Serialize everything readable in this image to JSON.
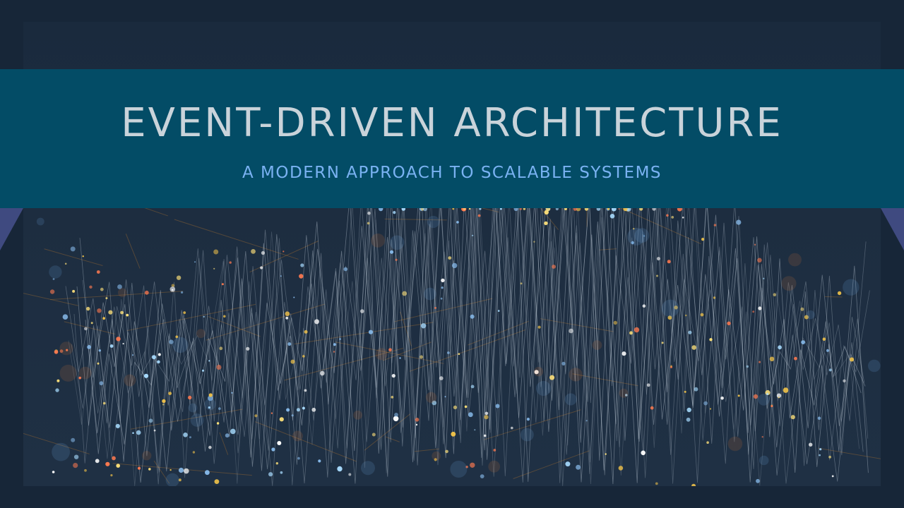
{
  "slide": {
    "title": "EVENT-DRIVEN ARCHITECTURE",
    "subtitle": "A MODERN APPROACH TO SCALABLE SYSTEMS"
  },
  "colors": {
    "background": "#172638",
    "banner": "#034c66",
    "title_text": "#c9d3da",
    "subtitle_text": "#7ab2f2",
    "ribbon_fold": "#3f4a80"
  },
  "image": {
    "name": "network-mesh-visualization"
  }
}
